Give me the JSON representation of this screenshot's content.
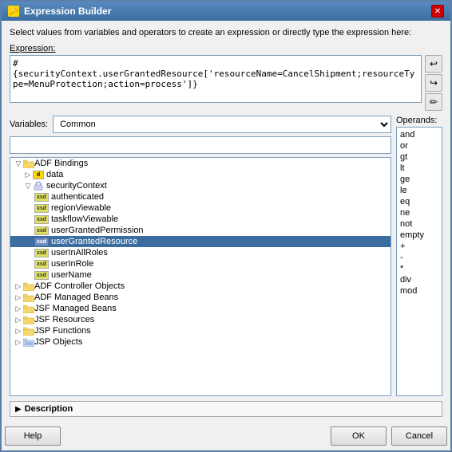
{
  "dialog": {
    "title": "Expression Builder",
    "icon": "🔑",
    "description": "Select values from variables and operators to create an expression or directly type the expression here:",
    "expression_label": "Expression:",
    "expression_value": "#{securityContext.userGrantedResource['resourceName=CancelShipment;resourceType=MenuProtection;action=process']}",
    "toolbar_buttons": [
      {
        "name": "redo-icon",
        "label": "↩"
      },
      {
        "name": "undo-icon",
        "label": "↪"
      },
      {
        "name": "edit-icon",
        "label": "✏"
      }
    ],
    "variables_label": "Variables:",
    "variables_value": "Common",
    "operands_label": "Operands:",
    "search_placeholder": "",
    "tree": {
      "items": [
        {
          "id": "adf-bindings",
          "label": "ADF Bindings",
          "level": 0,
          "type": "folder",
          "expanded": true,
          "selected": false
        },
        {
          "id": "data",
          "label": "data",
          "level": 1,
          "type": "data",
          "expanded": false,
          "selected": false
        },
        {
          "id": "security-context",
          "label": "securityContext",
          "level": 1,
          "type": "security",
          "expanded": true,
          "selected": false
        },
        {
          "id": "authenticated",
          "label": "authenticated",
          "level": 2,
          "type": "xsd",
          "selected": false
        },
        {
          "id": "region-viewable",
          "label": "regionViewable",
          "level": 2,
          "type": "xsd",
          "selected": false
        },
        {
          "id": "taskflow-viewable",
          "label": "taskflowViewable",
          "level": 2,
          "type": "xsd",
          "selected": false
        },
        {
          "id": "user-granted-permission",
          "label": "userGrantedPermission",
          "level": 2,
          "type": "xsd",
          "selected": false
        },
        {
          "id": "user-granted-resource",
          "label": "userGrantedResource",
          "level": 2,
          "type": "xsd",
          "selected": true
        },
        {
          "id": "user-in-all-roles",
          "label": "userInAllRoles",
          "level": 2,
          "type": "xsd",
          "selected": false
        },
        {
          "id": "user-in-role",
          "label": "userInRole",
          "level": 2,
          "type": "xsd",
          "selected": false
        },
        {
          "id": "user-name",
          "label": "userName",
          "level": 2,
          "type": "xsd",
          "selected": false
        },
        {
          "id": "adf-controller",
          "label": "ADF Controller Objects",
          "level": 0,
          "type": "folder",
          "expanded": false,
          "selected": false
        },
        {
          "id": "adf-managed-beans",
          "label": "ADF Managed Beans",
          "level": 0,
          "type": "folder",
          "expanded": false,
          "selected": false
        },
        {
          "id": "jsf-managed-beans",
          "label": "JSF Managed Beans",
          "level": 0,
          "type": "folder",
          "expanded": false,
          "selected": false
        },
        {
          "id": "jsf-resources",
          "label": "JSF Resources",
          "level": 0,
          "type": "folder",
          "expanded": false,
          "selected": false
        },
        {
          "id": "jsp-functions",
          "label": "JSP Functions",
          "level": 0,
          "type": "folder",
          "expanded": false,
          "selected": false
        },
        {
          "id": "jsp-objects",
          "label": "JSP Objects",
          "level": 0,
          "type": "folder-special",
          "expanded": false,
          "selected": false
        }
      ]
    },
    "operands": [
      "and",
      "or",
      "gt",
      "lt",
      "ge",
      "le",
      "eq",
      "ne",
      "not",
      "empty",
      "+",
      "-",
      "*",
      "div",
      "mod"
    ],
    "description_footer": "Description",
    "buttons": {
      "help": "Help",
      "ok": "OK",
      "cancel": "Cancel"
    }
  }
}
